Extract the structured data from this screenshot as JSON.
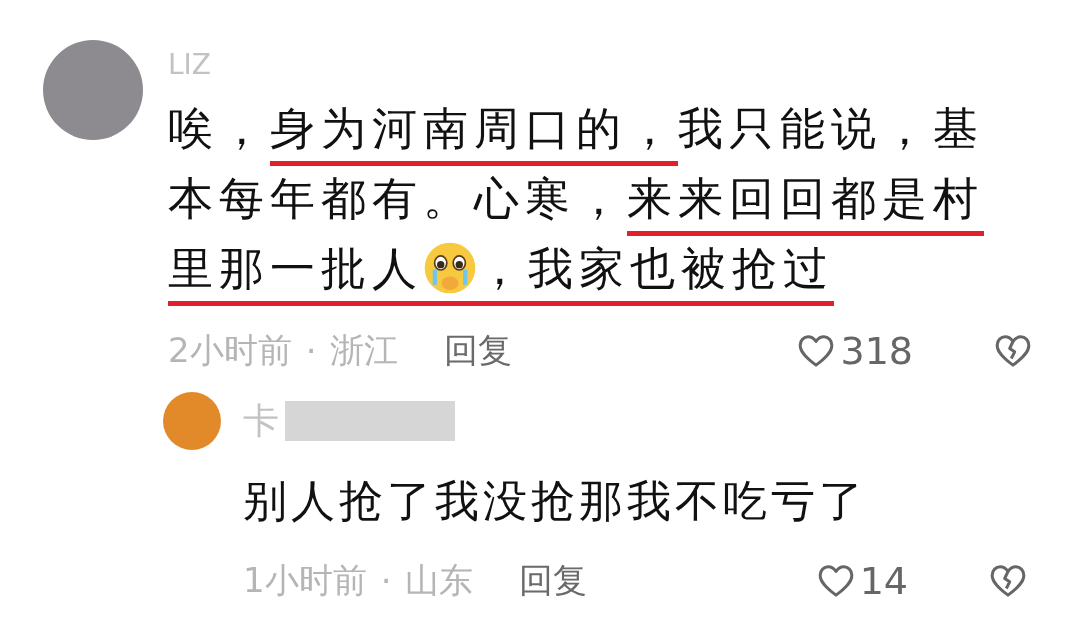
{
  "comments": [
    {
      "username": "LIZ",
      "lines": [
        [
          {
            "kind": "text",
            "text": "唉，",
            "underlined": false
          },
          {
            "kind": "text",
            "text": "身为河南周口的，",
            "underlined": true
          },
          {
            "kind": "text",
            "text": "我只能说，基",
            "underlined": false
          }
        ],
        [
          {
            "kind": "text",
            "text": "本每年都有。心寒，",
            "underlined": false
          },
          {
            "kind": "text",
            "text": "来来回回都是村",
            "underlined": true
          }
        ],
        [
          {
            "kind": "text",
            "text": "里那一批人",
            "underlined": true
          },
          {
            "kind": "emoji",
            "underlined": true
          },
          {
            "kind": "text",
            "text": "，我家也被抢过",
            "underlined": true
          }
        ]
      ],
      "time": "2小时前",
      "separator": "·",
      "location": "浙江",
      "reply": "回复",
      "likes": "318",
      "children": [
        {
          "username": "卡",
          "username_blurred": true,
          "lines": [
            [
              {
                "kind": "text",
                "text": "别人抢了我没抢那我不吃亏了",
                "underlined": false
              }
            ]
          ],
          "time": "1小时前",
          "separator": "·",
          "location": "山东",
          "reply": "回复",
          "likes": "14"
        }
      ]
    }
  ]
}
